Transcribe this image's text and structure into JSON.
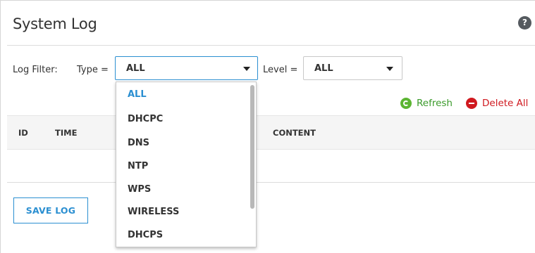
{
  "page": {
    "title": "System Log",
    "help_icon": "?"
  },
  "filter": {
    "label": "Log Filter:",
    "type_label": "Type =",
    "type_value": "ALL",
    "level_label": "Level =",
    "level_value": "ALL"
  },
  "actions": {
    "refresh": "Refresh",
    "delete_all": "Delete All"
  },
  "table": {
    "columns": [
      "ID",
      "TIME",
      "CONTENT"
    ]
  },
  "save_log": "SAVE LOG",
  "type_dropdown": {
    "options": [
      "ALL",
      "DHCPC",
      "DNS",
      "NTP",
      "WPS",
      "WIRELESS",
      "DHCPS"
    ],
    "selected": "ALL"
  },
  "icons": {
    "help": "question-circle-icon",
    "refresh": "refresh-icon",
    "delete_all": "minus-circle-icon",
    "dropdown_arrow": "caret-down-icon"
  },
  "colors": {
    "accent": "#2b8fd1",
    "refresh_green": "#5cb533",
    "delete_red": "#d0191f",
    "help_gray": "#555a5f"
  }
}
